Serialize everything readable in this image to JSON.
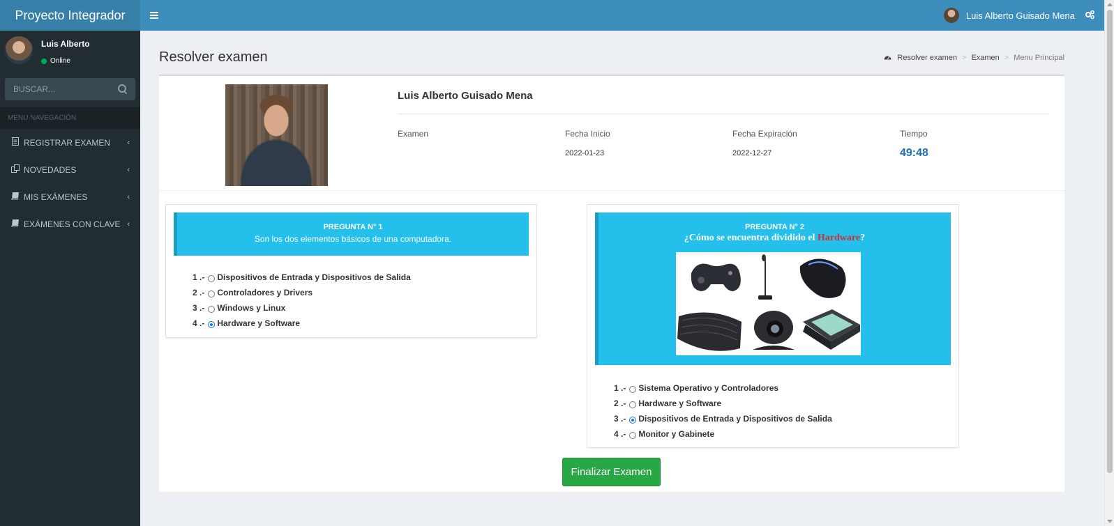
{
  "header": {
    "brand": "Proyecto Integrador",
    "user_name": "Luis Alberto Guisado Mena"
  },
  "sidebar": {
    "user": {
      "name": "Luis Alberto",
      "status": "Online"
    },
    "search_placeholder": "BUSCAR...",
    "menu_header": "MENU NAVEGACIÓN",
    "items": [
      {
        "label": "REGISTRAR EXAMEN",
        "icon": "file-text-icon"
      },
      {
        "label": "NOVEDADES",
        "icon": "copy-icon"
      },
      {
        "label": "MIS EXÁMENES",
        "icon": "book-icon"
      },
      {
        "label": "EXÁMENES CON CLAVE",
        "icon": "book-icon"
      }
    ]
  },
  "page": {
    "title": "Resolver examen",
    "breadcrumb": [
      "Resolver examen",
      "Examen",
      "Menu Principal"
    ]
  },
  "profile": {
    "name": "Luis Alberto Guisado Mena",
    "fields": {
      "exam_label": "Examen",
      "exam_value": "",
      "start_label": "Fecha Inicio",
      "start_value": "2022-01-23",
      "expiry_label": "Fecha Expiración",
      "expiry_value": "2022-12-27",
      "time_label": "Tiempo",
      "time_value": "49:48"
    }
  },
  "questions": [
    {
      "number": "PREGUNTA N° 1",
      "text": "Son los dos elementos básicos de una computadora.",
      "options": [
        {
          "num": "1 .-",
          "text": "Dispositivos de Entrada y Dispositivos de Salida",
          "checked": false
        },
        {
          "num": "2 .-",
          "text": "Controladores y Drivers",
          "checked": false
        },
        {
          "num": "3 .-",
          "text": "Windows y Linux",
          "checked": false
        },
        {
          "num": "4 .-",
          "text": "Hardware y Software",
          "checked": true
        }
      ]
    },
    {
      "number": "PREGUNTA N° 2",
      "text_before": "¿Cómo se encuentra dividido el ",
      "text_highlight": "Hardware",
      "text_after": "?",
      "options": [
        {
          "num": "1 .-",
          "text": "Sistema Operativo y Controladores",
          "checked": false
        },
        {
          "num": "2 .-",
          "text": "Hardware y Software",
          "checked": false
        },
        {
          "num": "3 .-",
          "text": "Dispositivos de Entrada y Dispositivos de Salida",
          "checked": true
        },
        {
          "num": "4 .-",
          "text": "Monitor y Gabinete",
          "checked": false
        }
      ]
    }
  ],
  "actions": {
    "finish": "Finalizar Examen"
  },
  "colors": {
    "navbar": "#3c8dbc",
    "brand": "#367fa9",
    "sidebar": "#222d32",
    "question_header": "#24c0eb",
    "finish_button": "#28a745",
    "timer": "#1f6fb5"
  }
}
